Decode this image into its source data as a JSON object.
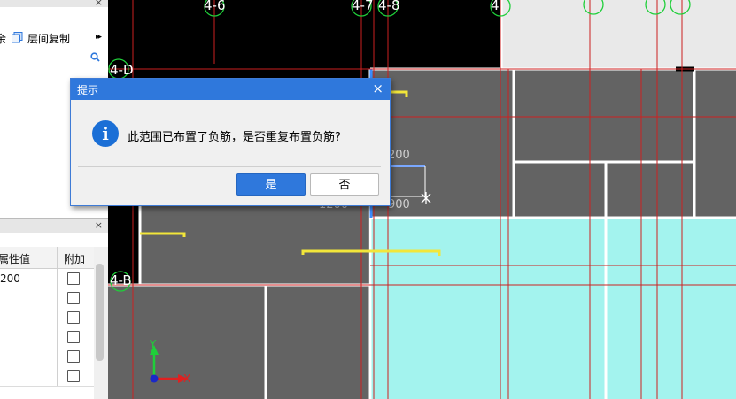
{
  "left_panel": {
    "top_close": "×",
    "toolbar": {
      "delete_fragment": "余",
      "floor_copy_label": "层间复制",
      "more_glyph": "▸▸"
    },
    "search_icon": "search-icon"
  },
  "property_panel": {
    "close": "×",
    "header": {
      "value_col": "属性值",
      "extra_col": "附加"
    },
    "rows": [
      {
        "value": "200",
        "checked": false
      },
      {
        "value": "",
        "checked": false
      },
      {
        "value": "",
        "checked": false
      },
      {
        "value": "",
        "checked": false
      },
      {
        "value": "",
        "checked": false
      },
      {
        "value": "",
        "checked": false
      }
    ]
  },
  "canvas": {
    "axis_labels": [
      "4-6",
      "4-7",
      "4-8",
      "4-D",
      "4-B",
      "4"
    ],
    "dimensions": [
      "200",
      "1200",
      "900"
    ],
    "ucs": {
      "x": "X",
      "y": "Y"
    },
    "colors": {
      "background": "#000000",
      "slab": "#636363",
      "highlight_region": "#a3f3ee",
      "grid_line": "#cc2020",
      "rebar": "#f2e63a",
      "axis_circle": "#1fcf3a",
      "beam": "#ffffff"
    }
  },
  "dialog": {
    "title": "提示",
    "close": "×",
    "message": "此范围已布置了负筋，是否重复布置负筋?",
    "icon": "info-icon",
    "yes_label": "是",
    "no_label": "否"
  }
}
